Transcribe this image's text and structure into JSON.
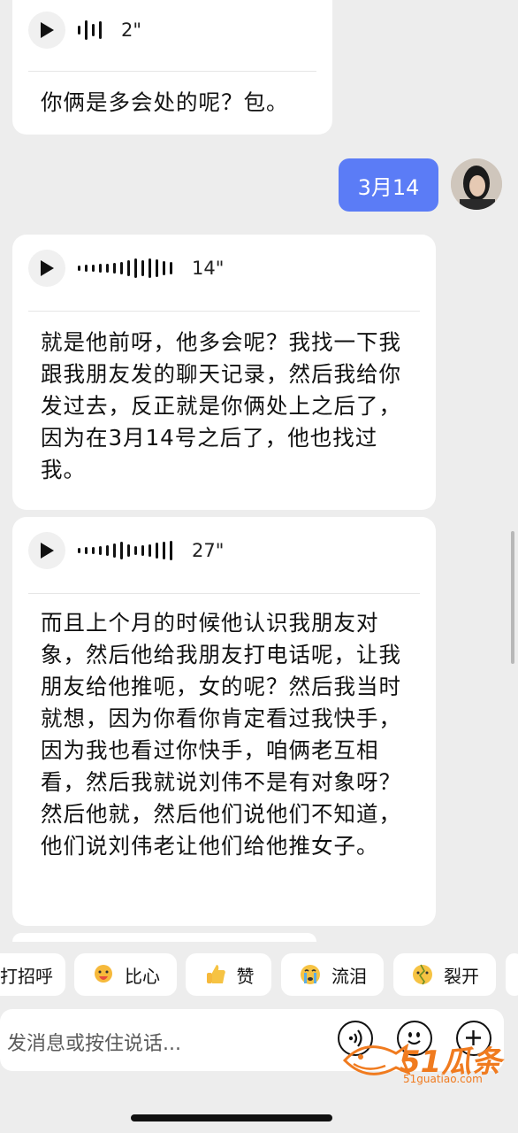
{
  "messages": {
    "m1": {
      "duration": "2\"",
      "text": "你俩是多会处的呢？包。"
    },
    "sent": {
      "text": "3月14"
    },
    "m2": {
      "duration": "14\"",
      "text": "就是他前呀，他多会呢？我找一下我跟我朋友发的聊天记录，然后我给你发过去，反正就是你俩处上之后了，因为在3月14号之后了，他也找过我。"
    },
    "m3": {
      "duration": "27\"",
      "text": "而且上个月的时候他认识我朋友对象，然后他给我朋友打电话呢，让我朋友给他推呃，女的呢？然后我当时就想，因为你看你肯定看过我快手，因为我也看过你快手，咱俩老互相看，然后我就说刘伟不是有对象呀？然后他就，然后他们说他们不知道，他们说刘伟老让他们给他推女子。"
    }
  },
  "quick_replies": [
    {
      "label": "打招呼",
      "icon": "wave-emoji-icon"
    },
    {
      "label": "比心",
      "icon": "heart-hands-emoji-icon"
    },
    {
      "label": "赞",
      "icon": "thumbs-up-emoji-icon"
    },
    {
      "label": "流泪",
      "icon": "crying-emoji-icon"
    },
    {
      "label": "裂开",
      "icon": "cracked-emoji-icon"
    }
  ],
  "input": {
    "placeholder": "发消息或按住说话..."
  },
  "watermark": {
    "brand": "51瓜条",
    "url": "51guatiao.com"
  },
  "colors": {
    "accent": "#5b7cf6",
    "bubble": "#ffffff",
    "background": "#ededed"
  }
}
